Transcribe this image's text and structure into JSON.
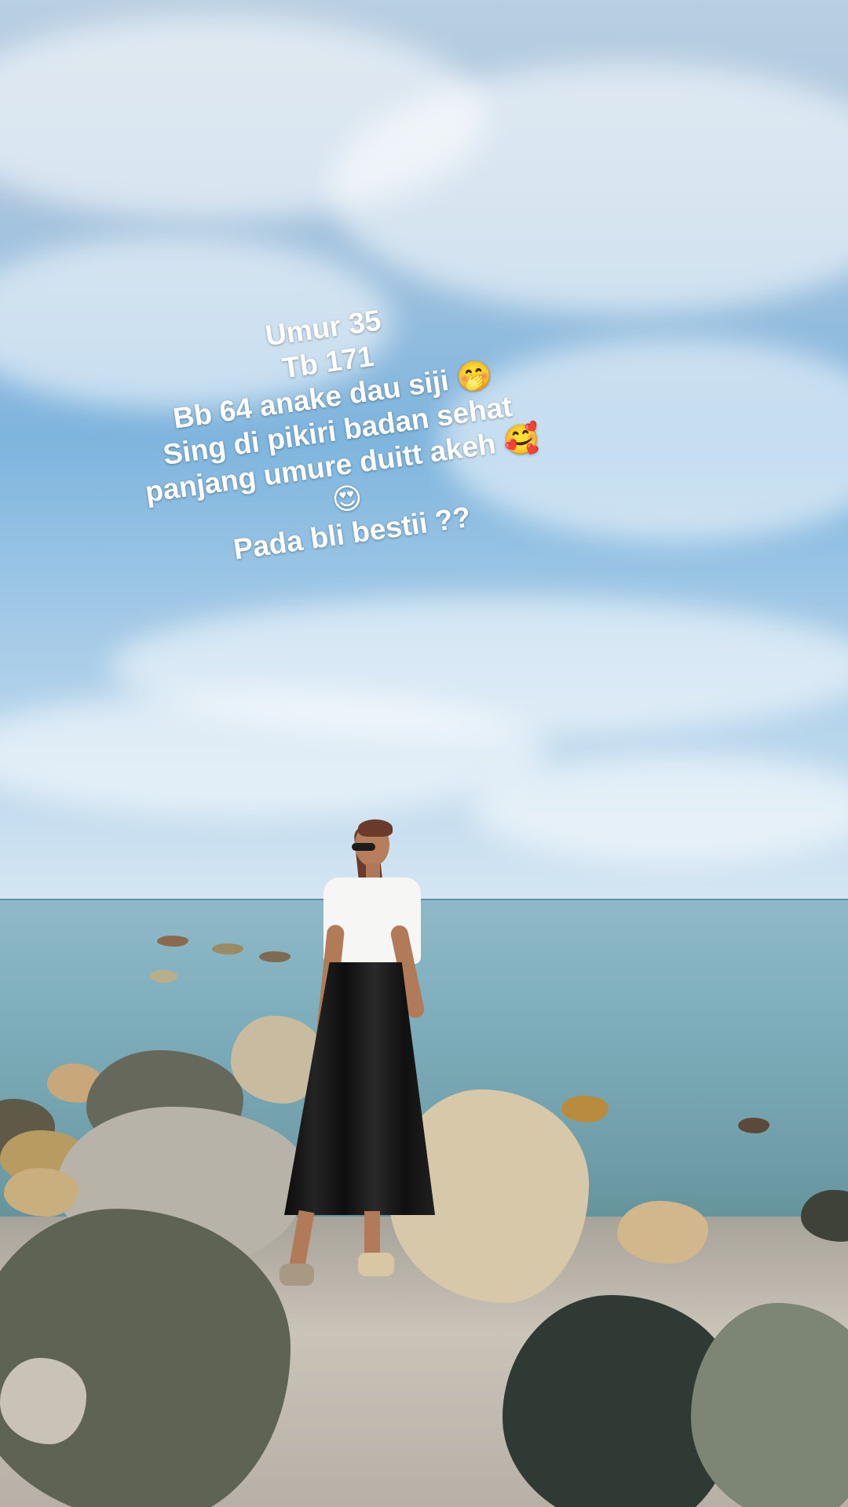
{
  "caption": {
    "lines": [
      "Umur 35",
      "Tb 171",
      "Bb 64 anake dau siji 🤭",
      "Sing di pikiri badan sehat",
      "panjang umure duitt akeh 🥰",
      "😍",
      "Pada bli bestii ??"
    ]
  },
  "scene": {
    "sky_color": "#7eb5de",
    "sea_color": "#7eaebc",
    "rock_color": "#6e6f5c",
    "sand_color": "#c9c3b8"
  }
}
